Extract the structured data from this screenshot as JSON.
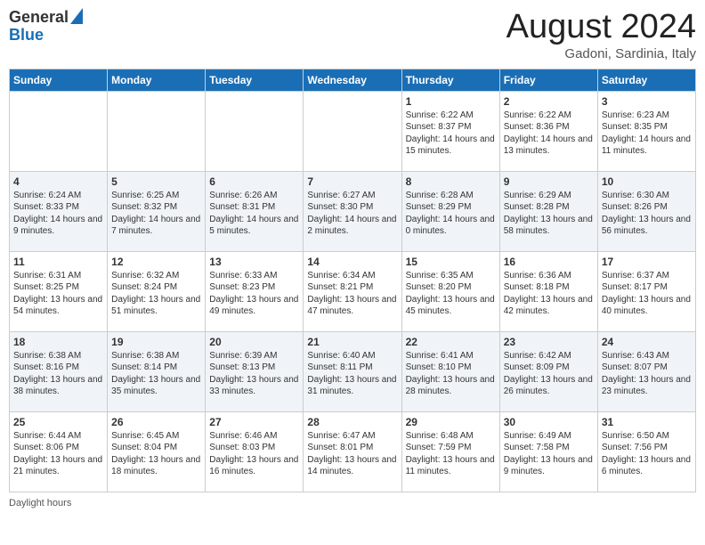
{
  "header": {
    "logo_general": "General",
    "logo_blue": "Blue",
    "month_title": "August 2024",
    "location": "Gadoni, Sardinia, Italy"
  },
  "days_of_week": [
    "Sunday",
    "Monday",
    "Tuesday",
    "Wednesday",
    "Thursday",
    "Friday",
    "Saturday"
  ],
  "weeks": [
    [
      {
        "num": "",
        "info": ""
      },
      {
        "num": "",
        "info": ""
      },
      {
        "num": "",
        "info": ""
      },
      {
        "num": "",
        "info": ""
      },
      {
        "num": "1",
        "info": "Sunrise: 6:22 AM\nSunset: 8:37 PM\nDaylight: 14 hours and 15 minutes."
      },
      {
        "num": "2",
        "info": "Sunrise: 6:22 AM\nSunset: 8:36 PM\nDaylight: 14 hours and 13 minutes."
      },
      {
        "num": "3",
        "info": "Sunrise: 6:23 AM\nSunset: 8:35 PM\nDaylight: 14 hours and 11 minutes."
      }
    ],
    [
      {
        "num": "4",
        "info": "Sunrise: 6:24 AM\nSunset: 8:33 PM\nDaylight: 14 hours and 9 minutes."
      },
      {
        "num": "5",
        "info": "Sunrise: 6:25 AM\nSunset: 8:32 PM\nDaylight: 14 hours and 7 minutes."
      },
      {
        "num": "6",
        "info": "Sunrise: 6:26 AM\nSunset: 8:31 PM\nDaylight: 14 hours and 5 minutes."
      },
      {
        "num": "7",
        "info": "Sunrise: 6:27 AM\nSunset: 8:30 PM\nDaylight: 14 hours and 2 minutes."
      },
      {
        "num": "8",
        "info": "Sunrise: 6:28 AM\nSunset: 8:29 PM\nDaylight: 14 hours and 0 minutes."
      },
      {
        "num": "9",
        "info": "Sunrise: 6:29 AM\nSunset: 8:28 PM\nDaylight: 13 hours and 58 minutes."
      },
      {
        "num": "10",
        "info": "Sunrise: 6:30 AM\nSunset: 8:26 PM\nDaylight: 13 hours and 56 minutes."
      }
    ],
    [
      {
        "num": "11",
        "info": "Sunrise: 6:31 AM\nSunset: 8:25 PM\nDaylight: 13 hours and 54 minutes."
      },
      {
        "num": "12",
        "info": "Sunrise: 6:32 AM\nSunset: 8:24 PM\nDaylight: 13 hours and 51 minutes."
      },
      {
        "num": "13",
        "info": "Sunrise: 6:33 AM\nSunset: 8:23 PM\nDaylight: 13 hours and 49 minutes."
      },
      {
        "num": "14",
        "info": "Sunrise: 6:34 AM\nSunset: 8:21 PM\nDaylight: 13 hours and 47 minutes."
      },
      {
        "num": "15",
        "info": "Sunrise: 6:35 AM\nSunset: 8:20 PM\nDaylight: 13 hours and 45 minutes."
      },
      {
        "num": "16",
        "info": "Sunrise: 6:36 AM\nSunset: 8:18 PM\nDaylight: 13 hours and 42 minutes."
      },
      {
        "num": "17",
        "info": "Sunrise: 6:37 AM\nSunset: 8:17 PM\nDaylight: 13 hours and 40 minutes."
      }
    ],
    [
      {
        "num": "18",
        "info": "Sunrise: 6:38 AM\nSunset: 8:16 PM\nDaylight: 13 hours and 38 minutes."
      },
      {
        "num": "19",
        "info": "Sunrise: 6:38 AM\nSunset: 8:14 PM\nDaylight: 13 hours and 35 minutes."
      },
      {
        "num": "20",
        "info": "Sunrise: 6:39 AM\nSunset: 8:13 PM\nDaylight: 13 hours and 33 minutes."
      },
      {
        "num": "21",
        "info": "Sunrise: 6:40 AM\nSunset: 8:11 PM\nDaylight: 13 hours and 31 minutes."
      },
      {
        "num": "22",
        "info": "Sunrise: 6:41 AM\nSunset: 8:10 PM\nDaylight: 13 hours and 28 minutes."
      },
      {
        "num": "23",
        "info": "Sunrise: 6:42 AM\nSunset: 8:09 PM\nDaylight: 13 hours and 26 minutes."
      },
      {
        "num": "24",
        "info": "Sunrise: 6:43 AM\nSunset: 8:07 PM\nDaylight: 13 hours and 23 minutes."
      }
    ],
    [
      {
        "num": "25",
        "info": "Sunrise: 6:44 AM\nSunset: 8:06 PM\nDaylight: 13 hours and 21 minutes."
      },
      {
        "num": "26",
        "info": "Sunrise: 6:45 AM\nSunset: 8:04 PM\nDaylight: 13 hours and 18 minutes."
      },
      {
        "num": "27",
        "info": "Sunrise: 6:46 AM\nSunset: 8:03 PM\nDaylight: 13 hours and 16 minutes."
      },
      {
        "num": "28",
        "info": "Sunrise: 6:47 AM\nSunset: 8:01 PM\nDaylight: 13 hours and 14 minutes."
      },
      {
        "num": "29",
        "info": "Sunrise: 6:48 AM\nSunset: 7:59 PM\nDaylight: 13 hours and 11 minutes."
      },
      {
        "num": "30",
        "info": "Sunrise: 6:49 AM\nSunset: 7:58 PM\nDaylight: 13 hours and 9 minutes."
      },
      {
        "num": "31",
        "info": "Sunrise: 6:50 AM\nSunset: 7:56 PM\nDaylight: 13 hours and 6 minutes."
      }
    ]
  ],
  "footer": {
    "label": "Daylight hours"
  }
}
